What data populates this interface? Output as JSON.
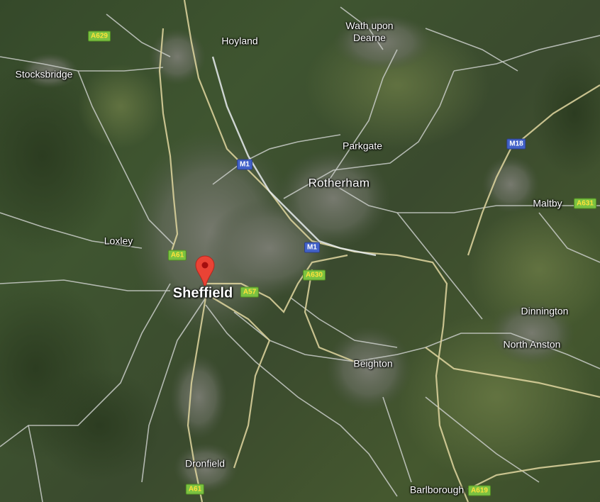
{
  "map": {
    "style": "satellite",
    "colors": {
      "pin": "#ea4335",
      "pin_dot": "#a50e0e",
      "motorway_shield": "#4262c9",
      "a_road_shield": "#7bc241",
      "a_road_shield_text": "#ffe23a",
      "road": "#d6d0a8",
      "urban": "#6f7366",
      "vegetation": "#3b4d2b"
    },
    "pin_icon": "map-pin-icon",
    "places": {
      "hoyland": "Hoyland",
      "wath_upon_dearne": "Wath upon\nDearne",
      "stocksbridge": "Stocksbridge",
      "parkgate": "Parkgate",
      "rotherham": "Rotherham",
      "maltby": "Maltby",
      "loxley": "Loxley",
      "sheffield": "Sheffield",
      "dinnington": "Dinnington",
      "north_anston": "North Anston",
      "beighton": "Beighton",
      "dronfield": "Dronfield",
      "barlborough": "Barlborough"
    },
    "road_shields": {
      "a629": "A629",
      "m1_north": "M1",
      "m18": "M18",
      "a631": "A631",
      "a61_north": "A61",
      "m1_south": "M1",
      "a630": "A630",
      "a57": "A57",
      "a61_south": "A61",
      "a619": "A619"
    }
  }
}
